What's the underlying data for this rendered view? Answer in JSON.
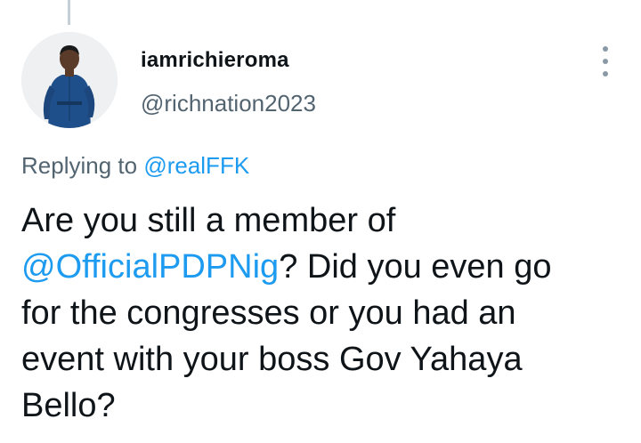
{
  "tweet": {
    "author": {
      "display_name": "iamrichieroma",
      "handle": "@richnation2023",
      "avatar_icon": "person-photo-icon"
    },
    "replying_to": {
      "prefix": "Replying to",
      "mention": "@realFFK"
    },
    "text": {
      "line1": "Are you still a member of",
      "mention": "@OfficialPDPNig",
      "line2_rest": "? Did you even go",
      "line3": "for the congresses or you had an",
      "line4": "event with your boss Gov Yahaya",
      "line5": "Bello?"
    },
    "more_options_icon": "vertical-ellipsis-icon"
  },
  "colors": {
    "text_primary": "#0f1419",
    "text_secondary": "#536471",
    "link": "#1d9bf0",
    "thread_line": "#c4cfd6"
  }
}
